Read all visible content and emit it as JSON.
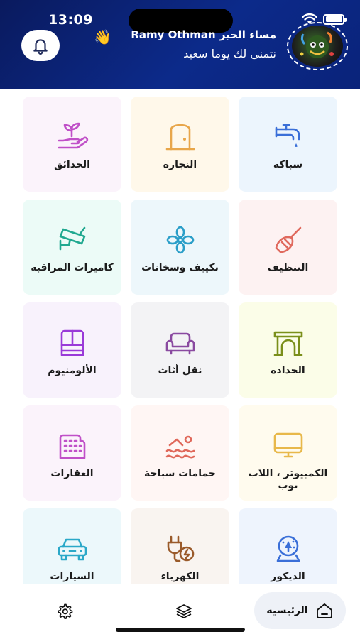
{
  "status_bar": {
    "time": "13:09"
  },
  "header": {
    "greeting": "مساء الخير Ramy Othman",
    "wave_emoji": "👋",
    "subtitle": "نتمني لك يوما سعيد",
    "bell_icon": "bell-icon",
    "avatar": "avatar-image"
  },
  "services": [
    {
      "label": "سباكة",
      "icon": "faucet-icon",
      "bg": "#ecf5fd",
      "color": "#3a6fd8"
    },
    {
      "label": "النجاره",
      "icon": "door-icon",
      "bg": "#fff8ea",
      "color": "#e8a64a"
    },
    {
      "label": "الحدائق",
      "icon": "plant-hand-icon",
      "bg": "#fbf3fb",
      "color": "#c050c8"
    },
    {
      "label": "التنظيف",
      "icon": "broom-icon",
      "bg": "#fdf2f2",
      "color": "#e06a5e"
    },
    {
      "label": "تكييف وسخانات",
      "icon": "fan-icon",
      "bg": "#edf7fb",
      "color": "#2a9ec8"
    },
    {
      "label": "كاميرات المراقبة",
      "icon": "cctv-icon",
      "bg": "#ecfbf7",
      "color": "#20a890"
    },
    {
      "label": "الحداده",
      "icon": "gate-icon",
      "bg": "#fbfde8",
      "color": "#7a8f1a"
    },
    {
      "label": "نقل أثاث",
      "icon": "sofa-icon",
      "bg": "#f3f3f5",
      "color": "#8a4aa0"
    },
    {
      "label": "الألومنيوم",
      "icon": "window-icon",
      "bg": "#f8f2fc",
      "color": "#9a3ad8"
    },
    {
      "label": "الكمبيوتر ، اللاب توب",
      "icon": "monitor-icon",
      "bg": "#fffbee",
      "color": "#e8b84a"
    },
    {
      "label": "حمامات سباحة",
      "icon": "swimmer-icon",
      "bg": "#fff6f4",
      "color": "#e0685a"
    },
    {
      "label": "العقارات",
      "icon": "building-icon",
      "bg": "#fbf3fb",
      "color": "#c050c8"
    },
    {
      "label": "الديكور",
      "icon": "snowglobe-icon",
      "bg": "#eef4fd",
      "color": "#3a6fd8"
    },
    {
      "label": "الكهرباء",
      "icon": "plug-icon",
      "bg": "#f9f4f0",
      "color": "#9a5a2a"
    },
    {
      "label": "السيارات",
      "icon": "car-icon",
      "bg": "#ecf8fb",
      "color": "#2aa8c8"
    }
  ],
  "bottom_nav": {
    "home_label": "الرئيسيه",
    "home_icon": "home-icon",
    "layers_icon": "layers-icon",
    "settings_icon": "gear-icon"
  }
}
